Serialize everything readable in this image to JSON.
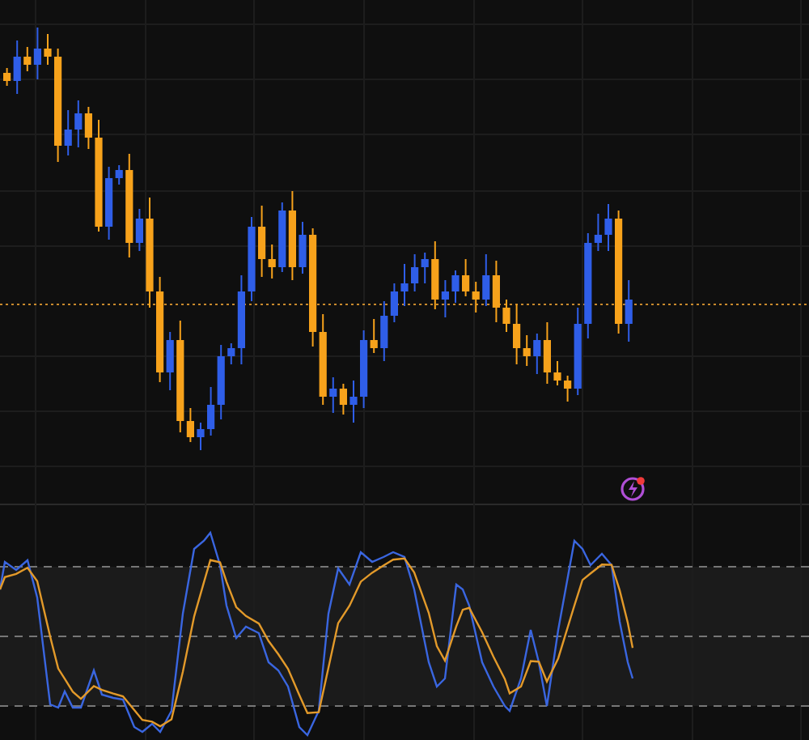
{
  "panels": [
    {
      "kind": "candlestick",
      "alert": {
        "kind": "lightning"
      }
    },
    {
      "kind": "oscillator"
    }
  ]
}
